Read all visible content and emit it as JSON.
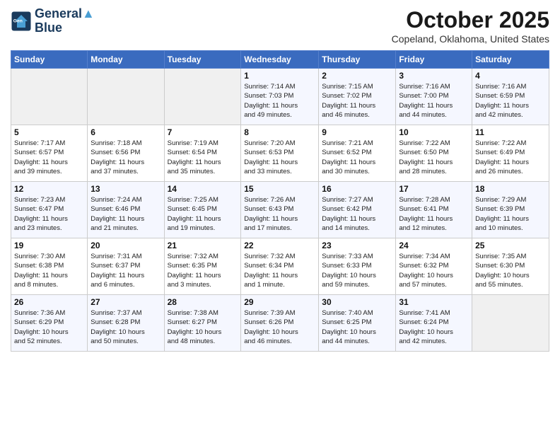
{
  "logo": {
    "line1": "General",
    "line2": "Blue"
  },
  "title": "October 2025",
  "location": "Copeland, Oklahoma, United States",
  "days_header": [
    "Sunday",
    "Monday",
    "Tuesday",
    "Wednesday",
    "Thursday",
    "Friday",
    "Saturday"
  ],
  "weeks": [
    [
      {
        "day": "",
        "info": ""
      },
      {
        "day": "",
        "info": ""
      },
      {
        "day": "",
        "info": ""
      },
      {
        "day": "1",
        "info": "Sunrise: 7:14 AM\nSunset: 7:03 PM\nDaylight: 11 hours\nand 49 minutes."
      },
      {
        "day": "2",
        "info": "Sunrise: 7:15 AM\nSunset: 7:02 PM\nDaylight: 11 hours\nand 46 minutes."
      },
      {
        "day": "3",
        "info": "Sunrise: 7:16 AM\nSunset: 7:00 PM\nDaylight: 11 hours\nand 44 minutes."
      },
      {
        "day": "4",
        "info": "Sunrise: 7:16 AM\nSunset: 6:59 PM\nDaylight: 11 hours\nand 42 minutes."
      }
    ],
    [
      {
        "day": "5",
        "info": "Sunrise: 7:17 AM\nSunset: 6:57 PM\nDaylight: 11 hours\nand 39 minutes."
      },
      {
        "day": "6",
        "info": "Sunrise: 7:18 AM\nSunset: 6:56 PM\nDaylight: 11 hours\nand 37 minutes."
      },
      {
        "day": "7",
        "info": "Sunrise: 7:19 AM\nSunset: 6:54 PM\nDaylight: 11 hours\nand 35 minutes."
      },
      {
        "day": "8",
        "info": "Sunrise: 7:20 AM\nSunset: 6:53 PM\nDaylight: 11 hours\nand 33 minutes."
      },
      {
        "day": "9",
        "info": "Sunrise: 7:21 AM\nSunset: 6:52 PM\nDaylight: 11 hours\nand 30 minutes."
      },
      {
        "day": "10",
        "info": "Sunrise: 7:22 AM\nSunset: 6:50 PM\nDaylight: 11 hours\nand 28 minutes."
      },
      {
        "day": "11",
        "info": "Sunrise: 7:22 AM\nSunset: 6:49 PM\nDaylight: 11 hours\nand 26 minutes."
      }
    ],
    [
      {
        "day": "12",
        "info": "Sunrise: 7:23 AM\nSunset: 6:47 PM\nDaylight: 11 hours\nand 23 minutes."
      },
      {
        "day": "13",
        "info": "Sunrise: 7:24 AM\nSunset: 6:46 PM\nDaylight: 11 hours\nand 21 minutes."
      },
      {
        "day": "14",
        "info": "Sunrise: 7:25 AM\nSunset: 6:45 PM\nDaylight: 11 hours\nand 19 minutes."
      },
      {
        "day": "15",
        "info": "Sunrise: 7:26 AM\nSunset: 6:43 PM\nDaylight: 11 hours\nand 17 minutes."
      },
      {
        "day": "16",
        "info": "Sunrise: 7:27 AM\nSunset: 6:42 PM\nDaylight: 11 hours\nand 14 minutes."
      },
      {
        "day": "17",
        "info": "Sunrise: 7:28 AM\nSunset: 6:41 PM\nDaylight: 11 hours\nand 12 minutes."
      },
      {
        "day": "18",
        "info": "Sunrise: 7:29 AM\nSunset: 6:39 PM\nDaylight: 11 hours\nand 10 minutes."
      }
    ],
    [
      {
        "day": "19",
        "info": "Sunrise: 7:30 AM\nSunset: 6:38 PM\nDaylight: 11 hours\nand 8 minutes."
      },
      {
        "day": "20",
        "info": "Sunrise: 7:31 AM\nSunset: 6:37 PM\nDaylight: 11 hours\nand 6 minutes."
      },
      {
        "day": "21",
        "info": "Sunrise: 7:32 AM\nSunset: 6:35 PM\nDaylight: 11 hours\nand 3 minutes."
      },
      {
        "day": "22",
        "info": "Sunrise: 7:32 AM\nSunset: 6:34 PM\nDaylight: 11 hours\nand 1 minute."
      },
      {
        "day": "23",
        "info": "Sunrise: 7:33 AM\nSunset: 6:33 PM\nDaylight: 10 hours\nand 59 minutes."
      },
      {
        "day": "24",
        "info": "Sunrise: 7:34 AM\nSunset: 6:32 PM\nDaylight: 10 hours\nand 57 minutes."
      },
      {
        "day": "25",
        "info": "Sunrise: 7:35 AM\nSunset: 6:30 PM\nDaylight: 10 hours\nand 55 minutes."
      }
    ],
    [
      {
        "day": "26",
        "info": "Sunrise: 7:36 AM\nSunset: 6:29 PM\nDaylight: 10 hours\nand 52 minutes."
      },
      {
        "day": "27",
        "info": "Sunrise: 7:37 AM\nSunset: 6:28 PM\nDaylight: 10 hours\nand 50 minutes."
      },
      {
        "day": "28",
        "info": "Sunrise: 7:38 AM\nSunset: 6:27 PM\nDaylight: 10 hours\nand 48 minutes."
      },
      {
        "day": "29",
        "info": "Sunrise: 7:39 AM\nSunset: 6:26 PM\nDaylight: 10 hours\nand 46 minutes."
      },
      {
        "day": "30",
        "info": "Sunrise: 7:40 AM\nSunset: 6:25 PM\nDaylight: 10 hours\nand 44 minutes."
      },
      {
        "day": "31",
        "info": "Sunrise: 7:41 AM\nSunset: 6:24 PM\nDaylight: 10 hours\nand 42 minutes."
      },
      {
        "day": "",
        "info": ""
      }
    ]
  ]
}
